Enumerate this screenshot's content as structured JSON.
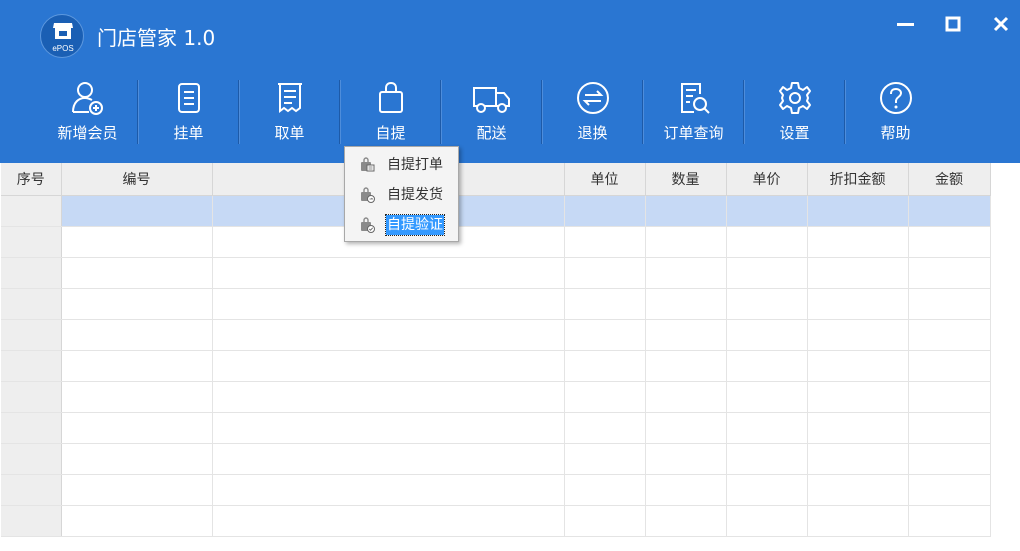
{
  "app": {
    "title": "门店管家 1.0",
    "logo_text": "ePOS",
    "brand_color": "#2a76d2"
  },
  "toolbar": {
    "items": [
      {
        "label": "新增会员",
        "icon": "add-member-icon"
      },
      {
        "label": "挂单",
        "icon": "hold-order-icon"
      },
      {
        "label": "取单",
        "icon": "retrieve-order-icon"
      },
      {
        "label": "自提",
        "icon": "shopping-bag-icon"
      },
      {
        "label": "配送",
        "icon": "delivery-truck-icon"
      },
      {
        "label": "退换",
        "icon": "exchange-icon"
      },
      {
        "label": "订单查询",
        "icon": "order-search-icon"
      },
      {
        "label": "设置",
        "icon": "gear-icon"
      },
      {
        "label": "帮助",
        "icon": "help-icon"
      }
    ]
  },
  "table": {
    "columns": [
      "序号",
      "编号",
      "",
      "单位",
      "数量",
      "单价",
      "折扣金额",
      "金额"
    ],
    "row_count": 11,
    "selected_row": 0,
    "selection_color": "#c6d9f5"
  },
  "dropdown": {
    "items": [
      {
        "label": "自提打单",
        "icon": "bag-print-icon"
      },
      {
        "label": "自提发货",
        "icon": "bag-ship-icon"
      },
      {
        "label": "自提验证",
        "icon": "bag-verify-icon",
        "active": true
      }
    ]
  }
}
